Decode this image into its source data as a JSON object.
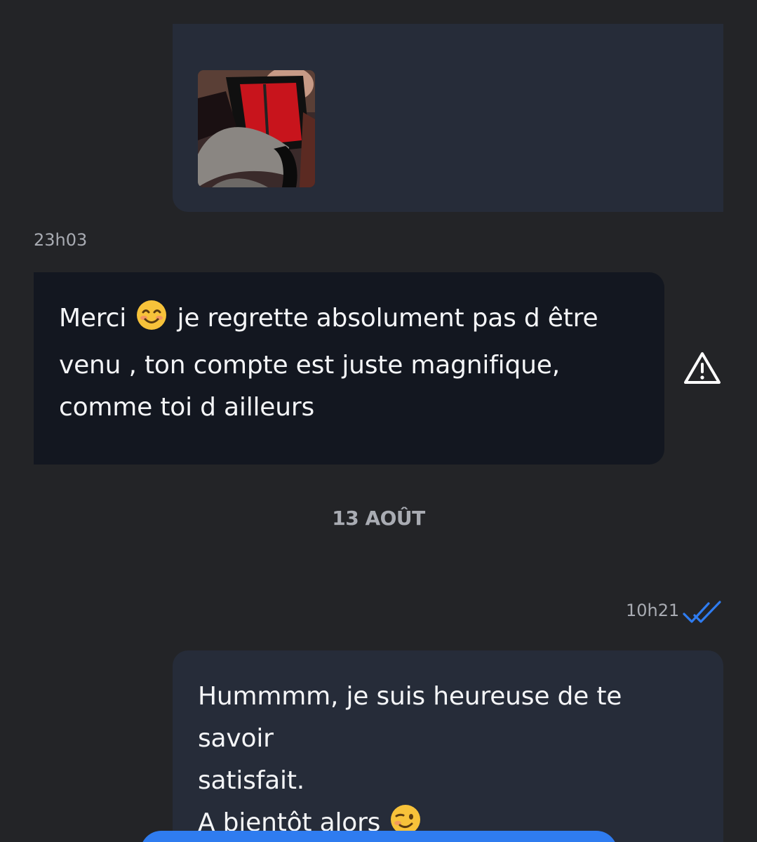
{
  "messages": [
    {
      "direction": "outgoing",
      "type": "image"
    },
    {
      "direction": "incoming",
      "time": "23h03",
      "text_before": "Merci",
      "emoji": "smiling-face-icon",
      "text_after": "je regrette absolument pas d être\nvenu , ton compte est juste magnifique,\ncomme toi d ailleurs"
    },
    {
      "direction": "outgoing",
      "time": "10h21",
      "status": "read",
      "text_before": "Hummmm, je suis heureuse de te savoir\nsatisfait.\nA bientôt alors",
      "emoji": "winking-face-icon"
    }
  ],
  "date_separator": "13 AOÛT",
  "colors": {
    "background": "#232427",
    "bubble_outgoing": "#262c39",
    "bubble_incoming": "#131720",
    "read_check": "#2f7cf0",
    "timestamp": "#a8abb2"
  }
}
